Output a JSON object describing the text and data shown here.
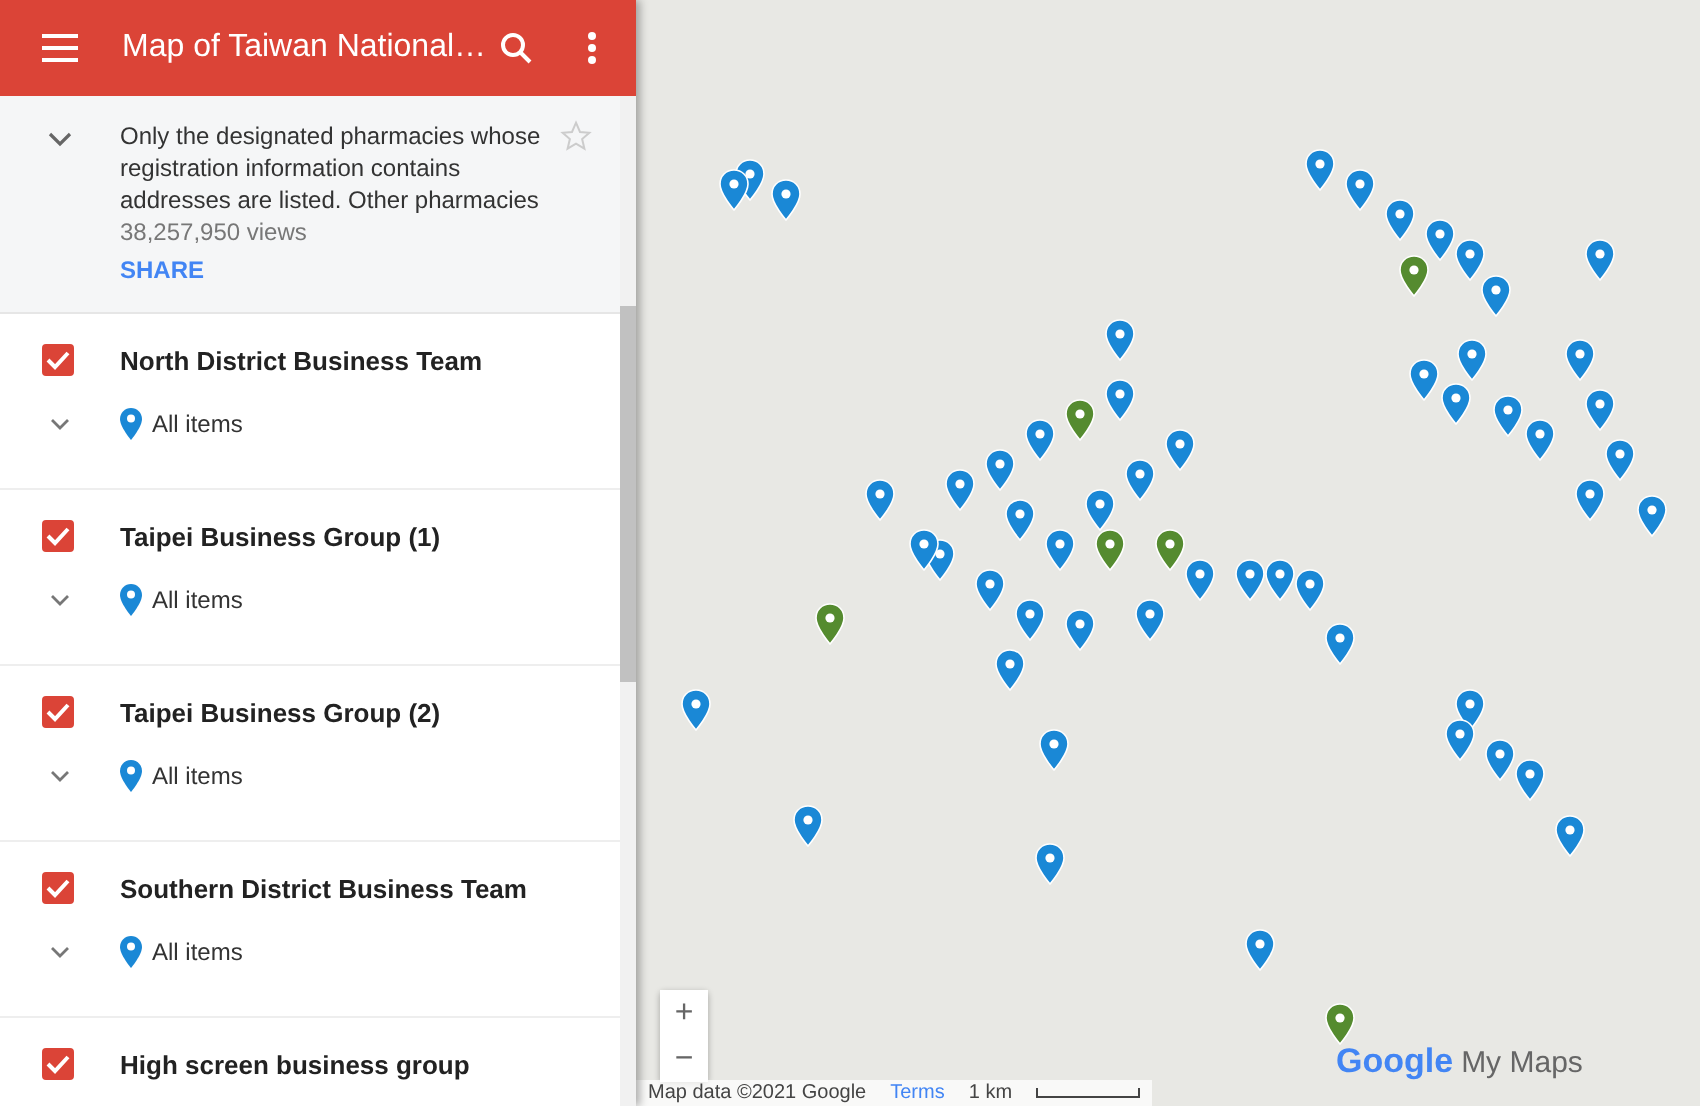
{
  "header": {
    "title": "Map of Taiwan National…"
  },
  "description": {
    "text": "Only the designated pharmacies whose registration information contains addresses are listed. Other pharmacies",
    "views": "38,257,950 views",
    "share": "SHARE"
  },
  "layers": [
    {
      "title": "North District Business Team",
      "checked": true,
      "items_label": "All items"
    },
    {
      "title": "Taipei Business Group (1)",
      "checked": true,
      "items_label": "All items"
    },
    {
      "title": "Taipei Business Group (2)",
      "checked": true,
      "items_label": "All items"
    },
    {
      "title": "Southern District Business Team",
      "checked": true,
      "items_label": "All items"
    },
    {
      "title": "High screen business group",
      "checked": true
    }
  ],
  "map": {
    "zoom_in": "+",
    "zoom_out": "−",
    "attribution": "Map data ©2021 Google",
    "terms": "Terms",
    "scale": "1 km",
    "logo": "Google",
    "logo_suffix": "My Maps"
  }
}
